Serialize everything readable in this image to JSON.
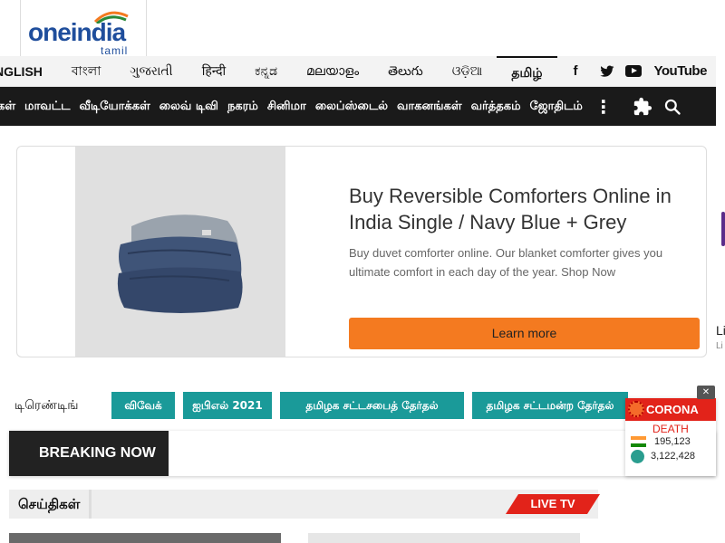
{
  "logo": {
    "text": "oneindia",
    "sub": "tamil"
  },
  "languages": [
    "NGLISH",
    "বাংলা",
    "ગુજરાતી",
    "हिन्दी",
    "ಕನ್ನಡ",
    "മലയാളം",
    "తెలుగు",
    "ଓଡ଼ିଆ",
    "தமிழ்"
  ],
  "active_language": "தமிழ்",
  "social": {
    "facebook": "f",
    "twitter": "t",
    "youtube": "YouTube"
  },
  "categories": [
    "கள்",
    "மாவட்ட",
    "வீடியோக்கள்",
    "லைவ் டிவி",
    "நகரம்",
    "சினிமா",
    "லைப்ஸ்டைல்",
    "வாகனங்கள்",
    "வர்த்தகம்",
    "ஜோதிடம்"
  ],
  "ad": {
    "title": "Buy Reversible Comforters Online in India Single / Navy Blue + Grey",
    "description": "Buy duvet comforter online. Our blanket comforter gives you ultimate comfort in each day of the year. Shop Now",
    "button": "Learn more"
  },
  "side_partial": {
    "line1": "Li",
    "line2": "Li"
  },
  "trending": {
    "label": "டிரெண்டிங்",
    "chips": [
      "விவேக்",
      "ஐபிஎல் 2021",
      "தமிழக சட்டசபைத் தேர்தல்",
      "தமிழக சட்டமன்ற தேர்தல்"
    ]
  },
  "breaking": "BREAKING NOW",
  "corona": {
    "title": "CORONA",
    "label": "DEATH",
    "india": "195,123",
    "world": "3,122,428",
    "close": "✕"
  },
  "news": {
    "section_title": "செய்திகள்",
    "live_tv": "LIVE TV"
  },
  "colors": {
    "accent_red": "#e2231a",
    "teal": "#1a9a99",
    "orange": "#f47a20",
    "dark": "#1a1a1a"
  }
}
